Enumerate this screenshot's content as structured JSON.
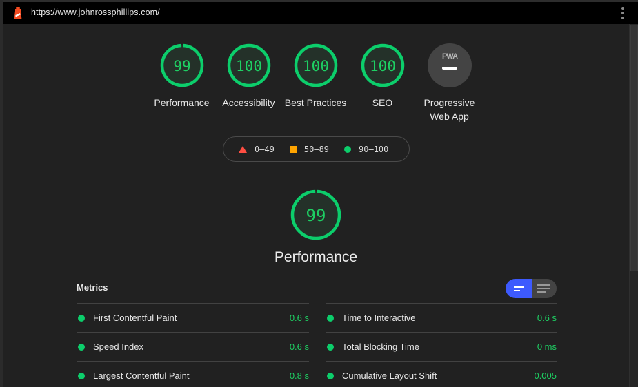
{
  "topbar": {
    "url": "https://www.johnrossphillips.com/",
    "logo_icon": "lighthouse-icon",
    "menu_icon": "kebab-menu-icon"
  },
  "colors": {
    "pass": "#0cce6b",
    "average": "#ffa400",
    "fail": "#ff4e42",
    "toggle_active": "#3d5afe"
  },
  "summary": {
    "gauges": [
      {
        "label": "Performance",
        "score": "99",
        "fraction": 0.99
      },
      {
        "label": "Accessibility",
        "score": "100",
        "fraction": 1.0
      },
      {
        "label": "Best Practices",
        "score": "100",
        "fraction": 1.0
      },
      {
        "label": "SEO",
        "score": "100",
        "fraction": 1.0
      },
      {
        "label": "Progressive Web App",
        "badge": "PWA",
        "icon": "pwa-icon"
      }
    ]
  },
  "legend": {
    "items": [
      {
        "shape": "triangle",
        "range": "0–49"
      },
      {
        "shape": "square",
        "range": "50–89"
      },
      {
        "shape": "circle",
        "range": "90–100"
      }
    ]
  },
  "performance": {
    "score": "99",
    "fraction": 0.99,
    "title": "Performance",
    "metrics_heading": "Metrics",
    "view_toggle": {
      "active": "compact",
      "options": [
        "compact-view",
        "expanded-view"
      ]
    },
    "metrics_left": [
      {
        "name": "First Contentful Paint",
        "value": "0.6 s"
      },
      {
        "name": "Speed Index",
        "value": "0.6 s"
      },
      {
        "name": "Largest Contentful Paint",
        "value": "0.8 s"
      }
    ],
    "metrics_right": [
      {
        "name": "Time to Interactive",
        "value": "0.6 s"
      },
      {
        "name": "Total Blocking Time",
        "value": "0 ms"
      },
      {
        "name": "Cumulative Layout Shift",
        "value": "0.005"
      }
    ]
  }
}
